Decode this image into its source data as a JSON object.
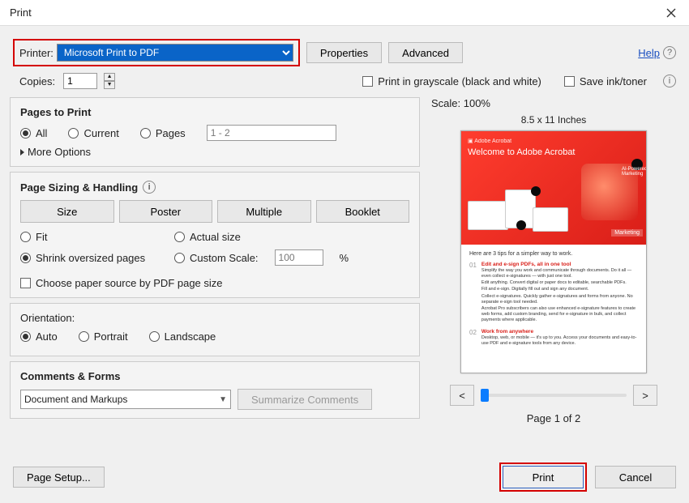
{
  "window": {
    "title": "Print"
  },
  "toprow": {
    "printer_label": "Printer:",
    "printer_selected": "Microsoft Print to PDF",
    "properties_btn": "Properties",
    "advanced_btn": "Advanced",
    "help_link": "Help"
  },
  "row2": {
    "copies_label": "Copies:",
    "copies_value": "1",
    "grayscale_label": "Print in grayscale (black and white)",
    "saveink_label": "Save ink/toner"
  },
  "pages": {
    "title": "Pages to Print",
    "all": "All",
    "current": "Current",
    "pages": "Pages",
    "range_value": "1 - 2",
    "more": "More Options"
  },
  "sizing": {
    "title": "Page Sizing & Handling",
    "size_btn": "Size",
    "poster_btn": "Poster",
    "multiple_btn": "Multiple",
    "booklet_btn": "Booklet",
    "fit": "Fit",
    "actual": "Actual size",
    "shrink": "Shrink oversized pages",
    "custom": "Custom Scale:",
    "custom_value": "100",
    "custom_pct": "%",
    "choose_paper": "Choose paper source by PDF page size"
  },
  "orientation": {
    "title": "Orientation:",
    "auto": "Auto",
    "portrait": "Portrait",
    "landscape": "Landscape"
  },
  "comments": {
    "title": "Comments & Forms",
    "selected": "Document and Markups",
    "summarize_btn": "Summarize Comments"
  },
  "right": {
    "scale": "Scale: 100%",
    "dims": "8.5 x 11 Inches",
    "prev_back": "<",
    "prev_next": ">",
    "page_label": "Page 1 of 2"
  },
  "preview": {
    "brand": "Adobe Acrobat",
    "welcome": "Welcome to Adobe Acrobat",
    "ai": "AI-Powered Marketing",
    "mkt": "Marketing",
    "tips": "Here are 3 tips for a simpler way to work.",
    "n1": "01",
    "t1": "Edit and e-sign PDFs, all in one tool",
    "p1a": "Simplify the way you work and communicate through documents. Do it all — even collect e-signatures — with just one tool.",
    "p1b": "Edit anything. Convert digital or paper docs to editable, searchable PDFs.",
    "p1c": "Fill and e-sign. Digitally fill out and sign any document.",
    "p1d": "Collect e-signatures. Quickly gather e-signatures and forms from anyone. No separate e-sign tool needed.",
    "p1e": "Acrobat Pro subscribers can also use enhanced e-signature features to create web forms, add custom branding, send for e-signature in bulk, and collect payments where applicable.",
    "n2": "02",
    "t2": "Work from anywhere",
    "p2a": "Desktop, web, or mobile — it's up to you. Access your documents and easy-to-use PDF and e-signature tools from any device."
  },
  "footer": {
    "page_setup": "Page Setup...",
    "print": "Print",
    "cancel": "Cancel"
  }
}
